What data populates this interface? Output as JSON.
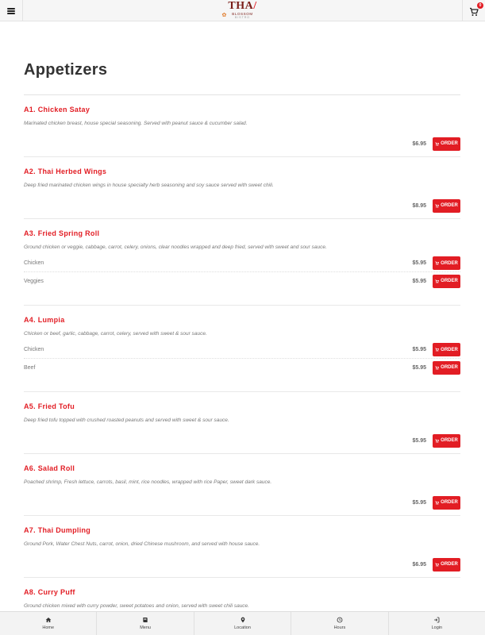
{
  "header": {
    "logo_main": "THAI",
    "logo_sub": "BLOSSOM",
    "logo_sub2": "BISTRO",
    "cart_count": "0"
  },
  "section": {
    "title": "Appetizers"
  },
  "items": [
    {
      "name": "A1. Chicken Satay",
      "desc": "Marinated chicken breast, house special seasoning. Served with peanut sauce & cucumber salad.",
      "price": "$6.95",
      "variants": []
    },
    {
      "name": "A2. Thai Herbed Wings",
      "desc": "Deep fried marinated chicken wings in house specialty herb seasoning and soy sauce served with sweet chili.",
      "price": "$8.95",
      "variants": []
    },
    {
      "name": "A3. Fried Spring Roll",
      "desc": "Ground chicken or veggie, cabbage, carrot, celery, onions, clear noodles wrapped and deep fried, served with sweet and sour sauce.",
      "price": "",
      "variants": [
        {
          "name": "Chicken",
          "price": "$5.95"
        },
        {
          "name": "Veggies",
          "price": "$5.95"
        }
      ]
    },
    {
      "name": "A4. Lumpia",
      "desc": "Chicken or beef, garlic, cabbage, carrot, celery, served with sweet & sour sauce.",
      "price": "",
      "variants": [
        {
          "name": "Chicken",
          "price": "$5.95"
        },
        {
          "name": "Beef",
          "price": "$5.95"
        }
      ]
    },
    {
      "name": "A5. Fried Tofu",
      "desc": "Deep fried tofu topped with crushed roasted peanuts and served with sweet & sour sauce.",
      "price": "$5.95",
      "variants": []
    },
    {
      "name": "A6. Salad Roll",
      "desc": "Poached shrimp, Fresh lettuce, carrots, basil, mint, rice noodles, wrapped with rice Paper, sweet dark sauce.",
      "price": "$5.95",
      "variants": []
    },
    {
      "name": "A7. Thai Dumpling",
      "desc": "Ground Pork, Water Chest Nuts, carrot, onion, dried Chinese mushroom, and served with house sauce.",
      "price": "$6.95",
      "variants": []
    },
    {
      "name": "A8. Curry Puff",
      "desc": "Ground chicken mixed with curry powder, sweet potatoes and onion, served with sweet chili sauce.",
      "price": "",
      "variants": []
    }
  ],
  "order_label": "ORDER",
  "nav": [
    {
      "label": "Home",
      "icon": "home-icon"
    },
    {
      "label": "Menu",
      "icon": "book-icon"
    },
    {
      "label": "Location",
      "icon": "map-pin-icon"
    },
    {
      "label": "Hours",
      "icon": "clock-icon"
    },
    {
      "label": "Login",
      "icon": "login-icon"
    }
  ],
  "colors": {
    "accent": "#e21d24",
    "brand": "#7a1d18"
  }
}
